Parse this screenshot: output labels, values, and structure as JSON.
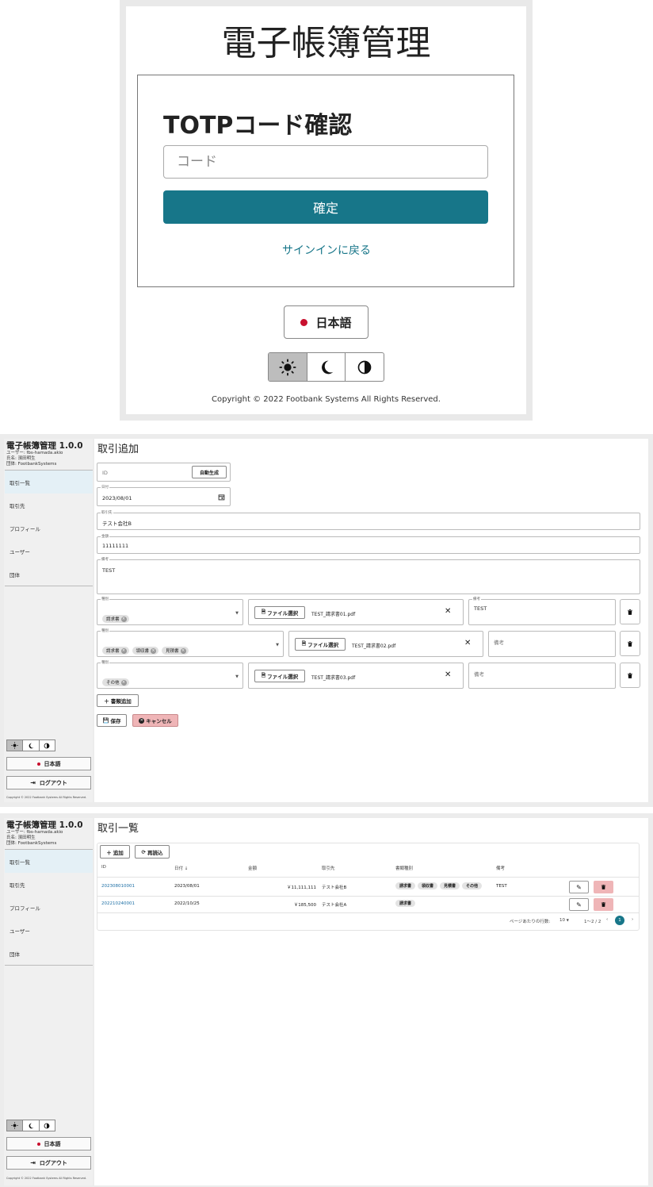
{
  "totp": {
    "app_title": "電子帳簿管理",
    "card_title": "TOTPコード確認",
    "code_placeholder": "コード",
    "confirm_label": "確定",
    "back_link": "サインインに戻る",
    "language": "日本語",
    "copyright": "Copyright © 2022 Footbank Systems All Rights Reserved."
  },
  "sidebar": {
    "app_title": "電子帳簿管理 1.0.0",
    "user_line": "ユーザー: fbs-hamada.akio",
    "name_line": "氏名: 濱田明生",
    "org_line": "団体: FootbankSystems",
    "nav": [
      "取引一覧",
      "取引先",
      "プロフィール",
      "ユーザー",
      "団体"
    ],
    "language": "日本語",
    "logout": "ログアウト",
    "copyright": "Copyright © 2022 Footbank Systems All Rights Reserved."
  },
  "add_form": {
    "title": "取引追加",
    "id_placeholder": "ID",
    "auto_generate": "自動生成",
    "date_label": "日付",
    "date_value": "2023/08/01",
    "partner_label": "取引先",
    "partner_value": "テスト会社B",
    "amount_label": "金額",
    "amount_value": "11111111",
    "remark_label": "備考",
    "remark_value": "TEST",
    "doc_type_label": "種別",
    "file_select": "ファイル選択",
    "doc_rows": [
      {
        "chips": [
          "請求書"
        ],
        "file": "TEST_請求書01.pdf",
        "remark_label": "備考",
        "remark_value": "TEST"
      },
      {
        "chips": [
          "請求書",
          "領収書",
          "見積書"
        ],
        "file": "TEST_請求書02.pdf",
        "remark_placeholder": "備考"
      },
      {
        "chips": [
          "その他"
        ],
        "file": "TEST_請求書03.pdf",
        "remark_placeholder": "備考"
      }
    ],
    "add_doc": "書類追加",
    "save": "保存",
    "cancel": "キャンセル"
  },
  "list": {
    "title": "取引一覧",
    "add": "追加",
    "reload": "再読込",
    "columns": [
      "ID",
      "日付 ↓",
      "金額",
      "取引先",
      "書類種別",
      "備考"
    ],
    "rows": [
      {
        "id": "202308010001",
        "date": "2023/08/01",
        "amount": "￥11,111,111",
        "partner": "テスト会社B",
        "docs": [
          "請求書",
          "領収書",
          "見積書",
          "その他"
        ],
        "remark": "TEST"
      },
      {
        "id": "202210240001",
        "date": "2022/10/25",
        "amount": "￥185,500",
        "partner": "テスト会社A",
        "docs": [
          "請求書"
        ],
        "remark": ""
      }
    ],
    "rows_per_page_label": "ページあたりの行数:",
    "rows_per_page": "10",
    "range": "1～2 / 2",
    "page": "1"
  },
  "colors": {
    "accent": "#177689",
    "cancel_bg": "#efb5b7",
    "delete_bg": "#efb5b7",
    "active_nav": "#e4f0f6"
  }
}
